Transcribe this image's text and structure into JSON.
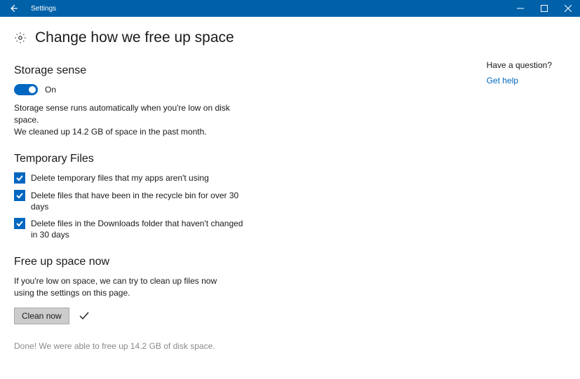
{
  "titlebar": {
    "app_name": "Settings"
  },
  "page": {
    "title": "Change how we free up space"
  },
  "storage_sense": {
    "heading": "Storage sense",
    "toggle_state": "On",
    "description_line1": "Storage sense runs automatically when you're low on disk space.",
    "description_line2": "We cleaned up 14.2 GB of space in the past month."
  },
  "temp_files": {
    "heading": "Temporary Files",
    "items": [
      "Delete temporary files that my apps aren't using",
      "Delete files that have been in the recycle bin for over 30 days",
      "Delete files in the Downloads folder that haven't changed in 30 days"
    ]
  },
  "free_up": {
    "heading": "Free up space now",
    "description": "If you're low on space, we can try to clean up files now using the settings on this page.",
    "button": "Clean now",
    "done": "Done! We were able to free up 14.2 GB of disk space."
  },
  "sidebar": {
    "question": "Have a question?",
    "help": "Get help"
  }
}
